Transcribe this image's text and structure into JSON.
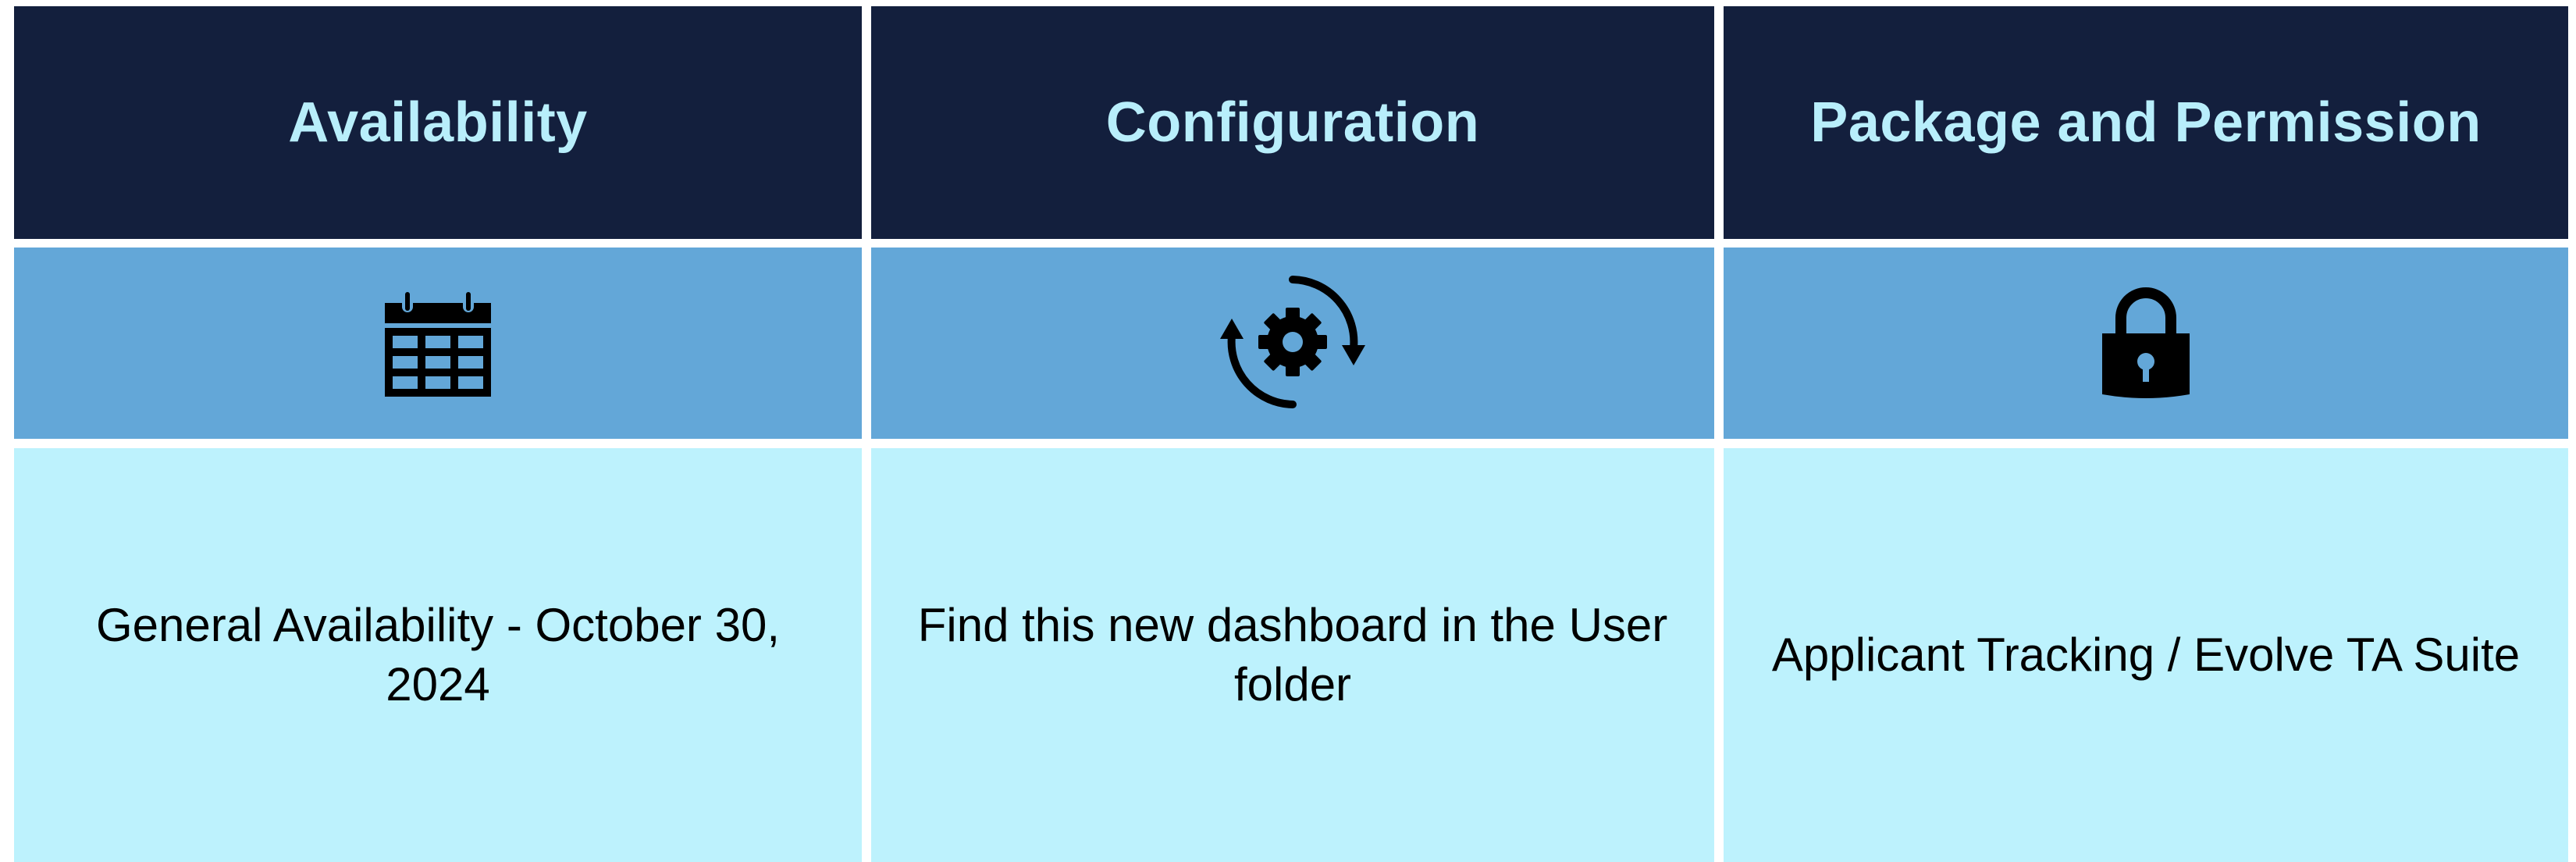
{
  "colors": {
    "header_bg": "#131f3d",
    "header_text": "#b8eefb",
    "icon_row_bg": "#63a7d8",
    "body_bg": "#bdf2fd",
    "body_text": "#000000",
    "divider": "#ffffff"
  },
  "columns": [
    {
      "heading": "Availability",
      "icon": "calendar-icon",
      "text": "General Availability - October 30, 2024"
    },
    {
      "heading": "Configuration",
      "icon": "gear-refresh-icon",
      "text": "Find this new dashboard in the User folder"
    },
    {
      "heading": "Package and Permission",
      "icon": "padlock-icon",
      "text": "Applicant Tracking / Evolve TA Suite"
    }
  ]
}
